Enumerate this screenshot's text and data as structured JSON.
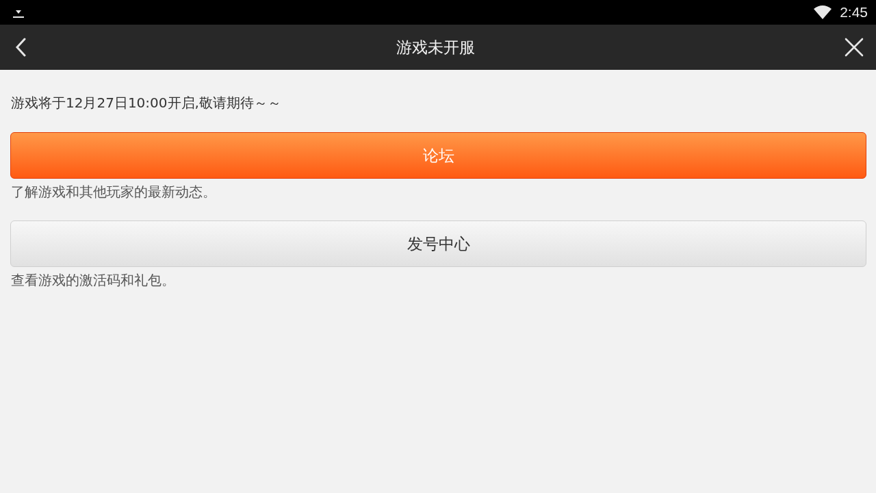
{
  "status_bar": {
    "time": "2:45"
  },
  "app_bar": {
    "title": "游戏未开服"
  },
  "notice": "游戏将于12月27日10:00开启,敬请期待～～",
  "actions": [
    {
      "kind": "primary",
      "label": "论坛",
      "description": "了解游戏和其他玩家的最新动态。"
    },
    {
      "kind": "secondary",
      "label": "发号中心",
      "description": "查看游戏的激活码和礼包。"
    }
  ]
}
